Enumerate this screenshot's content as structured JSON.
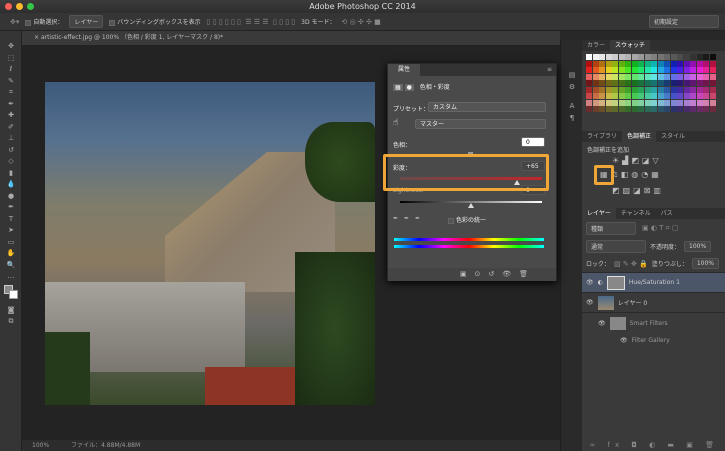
{
  "app": {
    "title": "Adobe Photoshop CC 2014"
  },
  "options": {
    "auto_select": "自動選択：",
    "layer_select": "レイヤー",
    "show_bbox": "バウンディングボックスを表示",
    "mode_3d": "3D モード：",
    "workspace": "初期設定"
  },
  "document": {
    "tab": "artistic-effect.jpg @ 100% （色相 / 彩度 1, レイヤーマスク / 8)*",
    "zoom": "100%",
    "file_info": "ファイル：4.88M/4.88M"
  },
  "properties": {
    "tab": "属性",
    "title": "色相・彩度",
    "preset_label": "プリセット：",
    "preset_value": "カスタム",
    "channel": "マスター",
    "hue_label": "色相：",
    "hue_value": "0",
    "saturation_label": "彩度：",
    "saturation_value": "+65",
    "saturation_fraction": 0.825,
    "lightness_label": "Lightness:",
    "lightness_value": "0",
    "colorize": "色彩の統一"
  },
  "swatch_panel": {
    "tabs": [
      "カラー",
      "スウォッチ"
    ]
  },
  "adjust_panel": {
    "tabs": [
      "ライブラリ",
      "色調補正",
      "スタイル"
    ],
    "add_label": "色調補正を追加"
  },
  "layers_panel": {
    "tabs": [
      "レイヤー",
      "チャンネル",
      "パス"
    ],
    "filter": "種類",
    "blend": "通常",
    "opacity_label": "不透明度：",
    "opacity": "100%",
    "lock_label": "ロック：",
    "fill_label": "塗りつぶし：",
    "fill": "100%",
    "layers": [
      {
        "name": "Hue/Saturation 1"
      },
      {
        "name": "レイヤー 0"
      },
      {
        "name": "Smart Filters"
      },
      {
        "name": "Filter Gallery"
      }
    ]
  },
  "colors": {
    "highlight": "#f1a638",
    "selected_layer": "#4b5669"
  }
}
